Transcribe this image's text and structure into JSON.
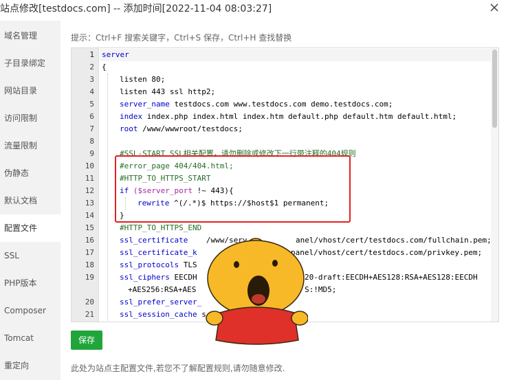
{
  "window": {
    "title": "站点修改[testdocs.com] -- 添加时间[2022-11-04 08:03:27]"
  },
  "sidebar": {
    "items": [
      {
        "label": "域名管理"
      },
      {
        "label": "子目录绑定"
      },
      {
        "label": "网站目录"
      },
      {
        "label": "访问限制"
      },
      {
        "label": "流量限制"
      },
      {
        "label": "伪静态"
      },
      {
        "label": "默认文档"
      },
      {
        "label": "配置文件",
        "active": true
      },
      {
        "label": "SSL"
      },
      {
        "label": "PHP版本"
      },
      {
        "label": "Composer"
      },
      {
        "label": "Tomcat"
      },
      {
        "label": "重定向"
      }
    ]
  },
  "editor": {
    "hint": "提示：Ctrl+F 搜索关键字，Ctrl+S 保存，Ctrl+H 查找替换",
    "line_numbers": [
      "1",
      "2",
      "3",
      "4",
      "5",
      "6",
      "7",
      "8",
      "9",
      "10",
      "11",
      "12",
      "13",
      "14",
      "15",
      "16",
      "17",
      "18",
      "19",
      "",
      "20",
      "21"
    ],
    "lines": {
      "l1": "server",
      "l2": "{",
      "l3_kw": "listen",
      "l3_rest": " 80;",
      "l4_kw": "listen",
      "l4_rest": " 443 ssl http2;",
      "l5_kw": "server_name",
      "l5_rest": " testdocs.com www.testdocs.com demo.testdocs.com;",
      "l6_kw": "index",
      "l6_rest": " index.php index.html index.htm default.php default.htm default.html;",
      "l7_kw": "root",
      "l7_rest": " /www/wwwroot/testdocs;",
      "l9": "#SSL-START SSL相关配置，请勿删除或修改下一行带注释的404规则",
      "l10": "#error_page 404/404.html;",
      "l11": "#HTTP_TO_HTTPS_START",
      "l12_kw": "if",
      "l12_var": " ($server_port",
      "l12_rest": " !~ 443){",
      "l13_kw": "rewrite",
      "l13_rest": " ^(/.*)$ https://$host$1 permanent;",
      "l14": "}",
      "l15": "#HTTP_TO_HTTPS_END",
      "l16_kw": "ssl_certificate",
      "l16_rest": "    /www/serv",
      "l16_tail": "anel/vhost/cert/testdocs.com/fullchain.pem;",
      "l17_kw": "ssl_certificate_k",
      "l17_tail": "panel/vhost/cert/testdocs.com/privkey.pem;",
      "l18_kw": "ssl_protocols",
      "l18_rest": " TLS",
      "l19_kw": "ssl_ciphers",
      "l19_rest": " EECDH",
      "l19_tail": "20-draft:EECDH+AES128:RSA+AES128:EECDH",
      "l19b_rest": "+AES256:RSA+AES",
      "l19b_tail": "S:!MD5;",
      "l20_kw": "ssl_prefer_server_",
      "l21_kw": "ssl_session_cache",
      "l21_rest": " s"
    }
  },
  "actions": {
    "save_label": "保存"
  },
  "footer": {
    "note": "此处为站点主配置文件,若您不了解配置规则,请勿随意修改."
  },
  "colors": {
    "save_button": "#20a53a",
    "highlight_box": "#e02020",
    "keyword": "#0000cc",
    "comment": "#236e25"
  },
  "icons": {
    "close": "close-icon",
    "sticker": "cartoon-bear-sticker"
  }
}
